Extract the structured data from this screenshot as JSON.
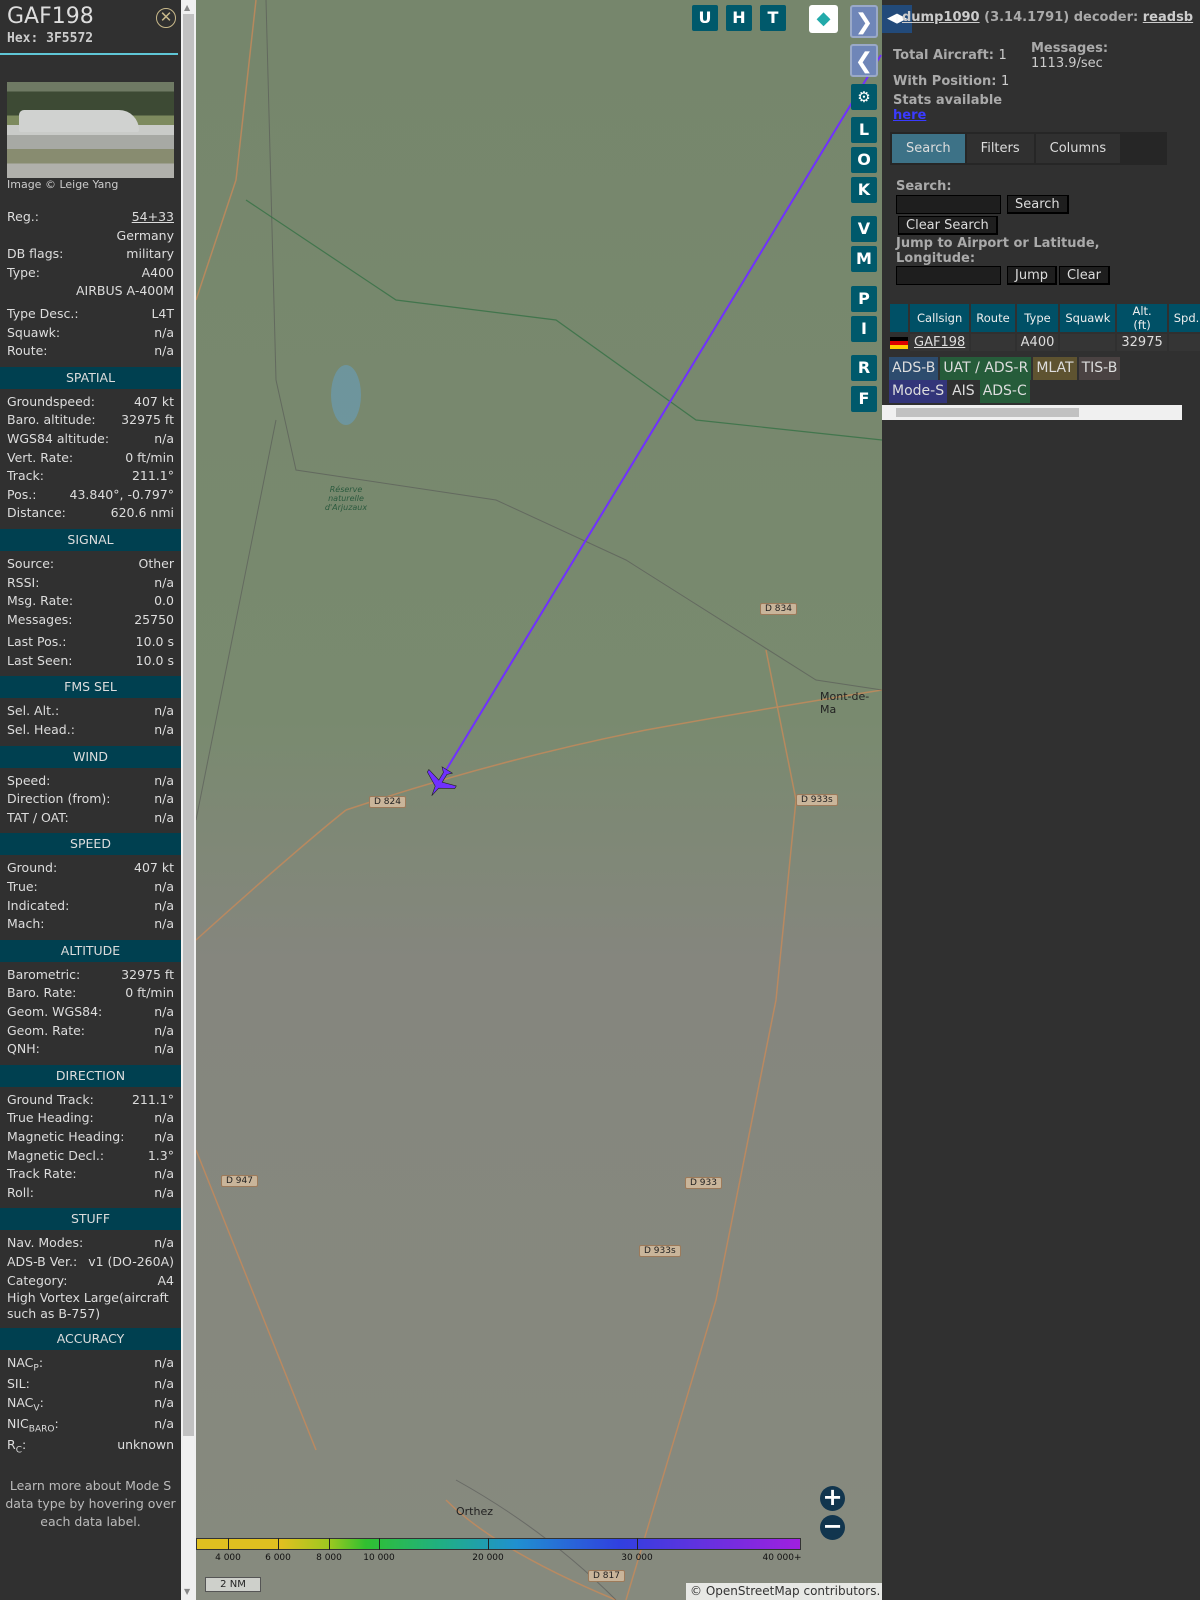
{
  "sidebar": {
    "callsign": "GAF198",
    "hex": "Hex: 3F5572",
    "image_credit": "Image © Leige Yang",
    "rows": [
      {
        "type": "row",
        "label": "Reg.:",
        "value": "54+33",
        "link": true
      },
      {
        "type": "row",
        "label": "",
        "value": "Germany"
      },
      {
        "type": "row",
        "label": "DB flags:",
        "value": "military"
      },
      {
        "type": "row",
        "label": "Type:",
        "value": "A400"
      },
      {
        "type": "row",
        "label": "",
        "value": "AIRBUS A-400M"
      },
      {
        "type": "gap"
      },
      {
        "type": "row",
        "label": "Type Desc.:",
        "value": "L4T"
      },
      {
        "type": "row",
        "label": "Squawk:",
        "value": "n/a"
      },
      {
        "type": "row",
        "label": "Route:",
        "value": "n/a"
      },
      {
        "type": "section",
        "label": "SPATIAL"
      },
      {
        "type": "row",
        "label": "Groundspeed:",
        "value": "407 kt"
      },
      {
        "type": "row",
        "label": "Baro. altitude:",
        "value": "32975 ft"
      },
      {
        "type": "row",
        "label": "WGS84 altitude:",
        "value": "n/a"
      },
      {
        "type": "row",
        "label": "Vert. Rate:",
        "value": "0 ft/min"
      },
      {
        "type": "row",
        "label": "Track:",
        "value": "211.1°"
      },
      {
        "type": "row",
        "label": "Pos.:",
        "value": "43.840°, -0.797°"
      },
      {
        "type": "row",
        "label": "Distance:",
        "value": "620.6 nmi"
      },
      {
        "type": "section",
        "label": "SIGNAL"
      },
      {
        "type": "row",
        "label": "Source:",
        "value": "Other"
      },
      {
        "type": "row",
        "label": "RSSI:",
        "value": "n/a"
      },
      {
        "type": "row",
        "label": "Msg. Rate:",
        "value": "0.0"
      },
      {
        "type": "row",
        "label": "Messages:",
        "value": "25750"
      },
      {
        "type": "gap"
      },
      {
        "type": "row",
        "label": "Last Pos.:",
        "value": "10.0 s"
      },
      {
        "type": "row",
        "label": "Last Seen:",
        "value": "10.0 s"
      },
      {
        "type": "section",
        "label": "FMS SEL"
      },
      {
        "type": "row",
        "label": "Sel. Alt.:",
        "value": "n/a"
      },
      {
        "type": "row",
        "label": "Sel. Head.:",
        "value": "n/a"
      },
      {
        "type": "section",
        "label": "WIND"
      },
      {
        "type": "row",
        "label": "Speed:",
        "value": "n/a"
      },
      {
        "type": "row",
        "label": "Direction (from):",
        "value": "n/a"
      },
      {
        "type": "row",
        "label": "TAT / OAT:",
        "value": "n/a"
      },
      {
        "type": "section",
        "label": "SPEED"
      },
      {
        "type": "row",
        "label": "Ground:",
        "value": "407 kt"
      },
      {
        "type": "row",
        "label": "True:",
        "value": "n/a"
      },
      {
        "type": "row",
        "label": "Indicated:",
        "value": "n/a"
      },
      {
        "type": "row",
        "label": "Mach:",
        "value": "n/a"
      },
      {
        "type": "section",
        "label": "ALTITUDE"
      },
      {
        "type": "row",
        "label": "Barometric:",
        "value": "32975 ft"
      },
      {
        "type": "row",
        "label": "Baro. Rate:",
        "value": "0 ft/min"
      },
      {
        "type": "row",
        "label": "Geom. WGS84:",
        "value": "n/a"
      },
      {
        "type": "row",
        "label": "Geom. Rate:",
        "value": "n/a"
      },
      {
        "type": "row",
        "label": "QNH:",
        "value": "n/a"
      },
      {
        "type": "section",
        "label": "DIRECTION"
      },
      {
        "type": "row",
        "label": "Ground Track:",
        "value": "211.1°"
      },
      {
        "type": "row",
        "label": "True Heading:",
        "value": "n/a"
      },
      {
        "type": "row",
        "label": "Magnetic Heading:",
        "value": "n/a"
      },
      {
        "type": "row",
        "label": "Magnetic Decl.:",
        "value": "1.3°"
      },
      {
        "type": "row",
        "label": "Track Rate:",
        "value": "n/a"
      },
      {
        "type": "row",
        "label": "Roll:",
        "value": "n/a"
      },
      {
        "type": "section",
        "label": "STUFF"
      },
      {
        "type": "row",
        "label": "Nav. Modes:",
        "value": "n/a"
      },
      {
        "type": "row",
        "label": "ADS-B Ver.:",
        "value": "v1 (DO-260A)"
      },
      {
        "type": "row",
        "label": "Category:",
        "value": "A4"
      },
      {
        "type": "text",
        "label": "High Vortex Large(aircraft such as B-757)"
      },
      {
        "type": "section",
        "label": "ACCURACY"
      },
      {
        "type": "row",
        "label": "NAC",
        "sub": "P",
        "value": "n/a"
      },
      {
        "type": "row",
        "label": "SIL:",
        "value": "n/a"
      },
      {
        "type": "row",
        "label": "NAC",
        "sub": "V",
        "value": "n/a"
      },
      {
        "type": "row",
        "label": "NIC",
        "sub": "BARO",
        "value": "n/a"
      },
      {
        "type": "row",
        "label": "R",
        "sub": "C",
        "value": "unknown"
      }
    ],
    "note": "Learn more about Mode S data type by hovering over each data label."
  },
  "map": {
    "top_buttons": [
      "U",
      "H",
      "T"
    ],
    "side_buttons": [
      "L",
      "O",
      "K",
      "V",
      "M",
      "P",
      "I",
      "R",
      "F"
    ],
    "labels": [
      "D 834",
      "D 824",
      "D 933s",
      "D 947",
      "D 933",
      "D 933s",
      "D 817"
    ],
    "towns": [
      "Mont-de-Ma",
      "Orthez",
      "Réserve naturelle d'Arjuzaux"
    ],
    "legend_ticks": [
      "4 000",
      "6 000",
      "8 000",
      "10 000",
      "20 000",
      "30 000",
      "40 000+"
    ],
    "scale": "2 NM",
    "attribution": "© OpenStreetMap contributors.",
    "track_color": "#7030ff"
  },
  "panel": {
    "header_app": "dump1090",
    "header_version": "(3.14.1791) decoder:",
    "header_decoder": "readsb",
    "total_label": "Total Aircraft:",
    "total": "1",
    "pos_label": "With Position:",
    "pos": "1",
    "msgs_label": "Messages:",
    "msgs": "1113.9/sec",
    "stats": "Stats available",
    "stats_link": "here",
    "tabs": [
      "Search",
      "Filters",
      "Columns"
    ],
    "search_label": "Search:",
    "search_btn": "Search",
    "clear_search": "Clear Search",
    "jump_label": "Jump to Airport or Latitude, Longitude:",
    "jump_btn": "Jump",
    "clear_btn": "Clear",
    "columns": [
      "",
      "Callsign",
      "Route",
      "Type",
      "Squawk",
      "Alt. (ft)",
      "Spd."
    ],
    "rows": [
      {
        "callsign": "GAF198",
        "route": "",
        "type": "A400",
        "squawk": "",
        "alt": "32975",
        "spd": ""
      }
    ],
    "badges": [
      {
        "label": "ADS-B",
        "color": "#2d4c6e"
      },
      {
        "label": "UAT / ADS-R",
        "color": "#265c3a"
      },
      {
        "label": "MLAT",
        "color": "#5e5330"
      },
      {
        "label": "TIS-B",
        "color": "#4a4242"
      },
      {
        "label": "Mode-S",
        "color": "#33357a"
      },
      {
        "label": "AIS",
        "color": "transparent"
      },
      {
        "label": "ADS-C",
        "color": "#265c3a"
      }
    ]
  }
}
